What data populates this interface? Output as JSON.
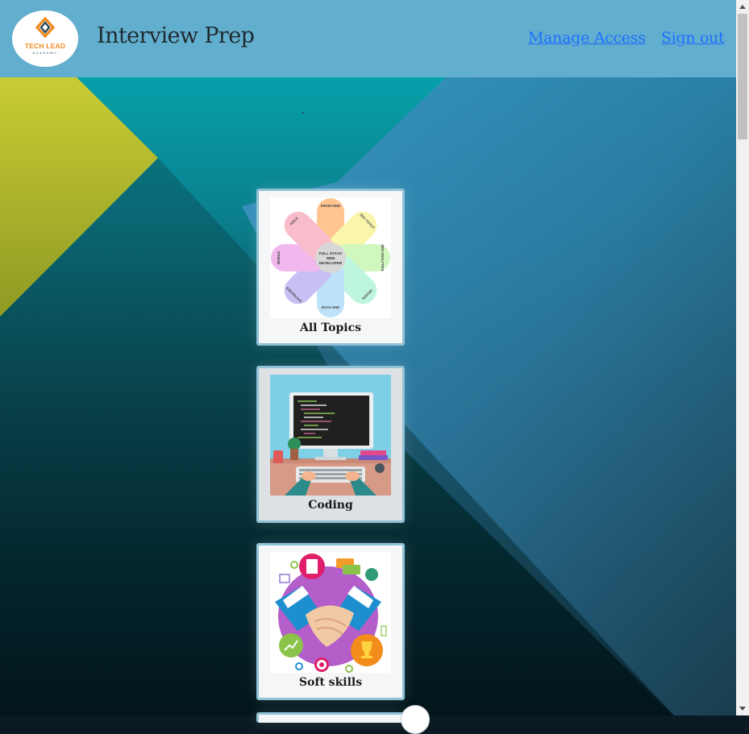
{
  "header": {
    "logo": {
      "name": "TECH LEAD",
      "sub": "ACADEMY"
    },
    "title": "Interview Prep",
    "links": [
      {
        "label": "Manage Access"
      },
      {
        "label": "Sign out"
      }
    ]
  },
  "cards": [
    {
      "label": "All Topics",
      "diagram": {
        "center": [
          "FULL STACK",
          "WEB",
          "DEVELOPER"
        ],
        "petals": [
          "FRONT-END",
          "DEV TOOLS",
          "SEO ANALYTICS",
          "DESIGN",
          "BACK-END",
          "DATABASES",
          "MOBILE",
          "AGILE"
        ]
      }
    },
    {
      "label": "Coding"
    },
    {
      "label": "Soft skills"
    }
  ],
  "colors": {
    "header_bg": "#62aece",
    "link": "#1e6fff",
    "card_border": "#8fc2d6",
    "accent_olive": "#c4c935",
    "accent_teal": "#06a0aa"
  }
}
